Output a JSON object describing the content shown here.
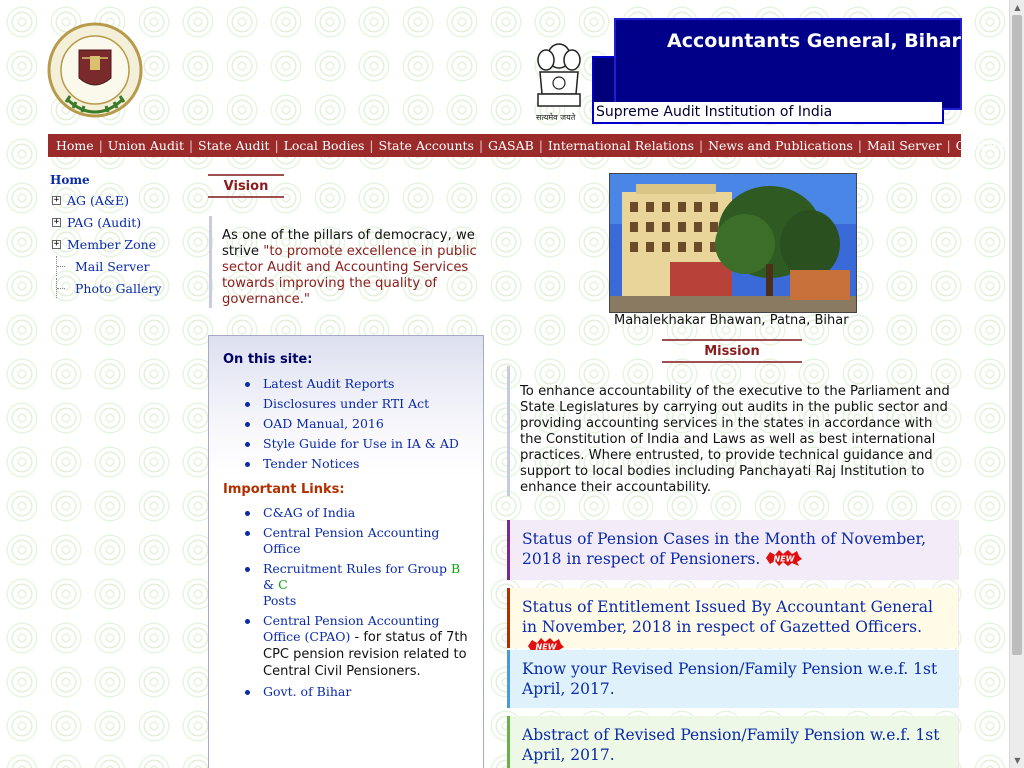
{
  "header": {
    "title": "Accountants General, Bihar",
    "subtitle": "Supreme Audit Institution of India",
    "emblem_motto": "सत्यमेव जयते"
  },
  "nav": [
    "Home",
    "Union Audit",
    "State Audit",
    "Local Bodies",
    "State Accounts",
    "GASAB",
    "International Relations",
    "News and Publications",
    "Mail Server",
    "Contact Us"
  ],
  "tree": {
    "home": "Home",
    "items": [
      "AG (A&E)",
      "PAG (Audit)",
      "Member Zone",
      "Mail Server",
      "Photo Gallery"
    ]
  },
  "vision": {
    "heading": "Vision",
    "text": "As one of the pillars of democracy, we strive ",
    "quote": "\"to promote excellence in public sector Audit and Accounting Services towards improving the quality of governance.\""
  },
  "site": {
    "heading": "On this site:",
    "links": [
      "Latest Audit Reports",
      "Disclosures under RTI Act",
      "OAD Manual, 2016",
      "Style Guide for Use in IA & AD",
      "Tender Notices"
    ],
    "important_heading": "Important Links:",
    "important": {
      "cag": "C&AG of India",
      "cpao": "Central Pension Accounting Office",
      "rr_prefix": "Recruitment Rules for Group ",
      "rr_b": "B",
      "rr_amp": " & ",
      "rr_c": "C",
      "rr_suffix": "Posts",
      "cpao2": "Central Pension Accounting Office (CPAO)",
      "cpao2_desc": " - for status of 7th CPC pension revision related to Central Civil Pensioners.",
      "bihar": "Govt. of Bihar"
    }
  },
  "photo": {
    "caption": "Mahalekhakar Bhawan, Patna, Bihar"
  },
  "mission": {
    "heading": "Mission",
    "text": "To enhance accountability of the executive to the Parliament and State Legislatures by carrying out audits in the public sector and providing accounting services in the states in accordance with the Constitution of India and Laws as well as best international practices. Where entrusted, to provide technical guidance and support to local bodies including Panchayati Raj Institution to enhance their accountability."
  },
  "notices": [
    {
      "text": "Status of Pension Cases in the Month of November, 2018 in respect of Pensioners.",
      "is_new": true,
      "bg": "#f3ecf8",
      "border": "#7a2a8a"
    },
    {
      "text": "Status of Entitlement Issued By Accountant General in November, 2018 in respect of Gazetted Officers.",
      "is_new": true,
      "bg": "#fffbe6",
      "border": "#b03000"
    },
    {
      "text": "Know your Revised Pension/Family Pension w.e.f. 1st April, 2017.",
      "is_new": false,
      "bg": "#dff2fb",
      "border": "#4a9ad8"
    },
    {
      "text": "Abstract of Revised Pension/Family Pension w.e.f. 1st April, 2017.",
      "is_new": false,
      "bg": "#edf9e6",
      "border": "#6ab04a"
    }
  ],
  "badge_text": "NEW",
  "colors": {
    "nav_bg": "#9b2b2b",
    "banner_bg": "#000088",
    "link": "#0a2aa8",
    "heading_red": "#8a1c1c"
  }
}
